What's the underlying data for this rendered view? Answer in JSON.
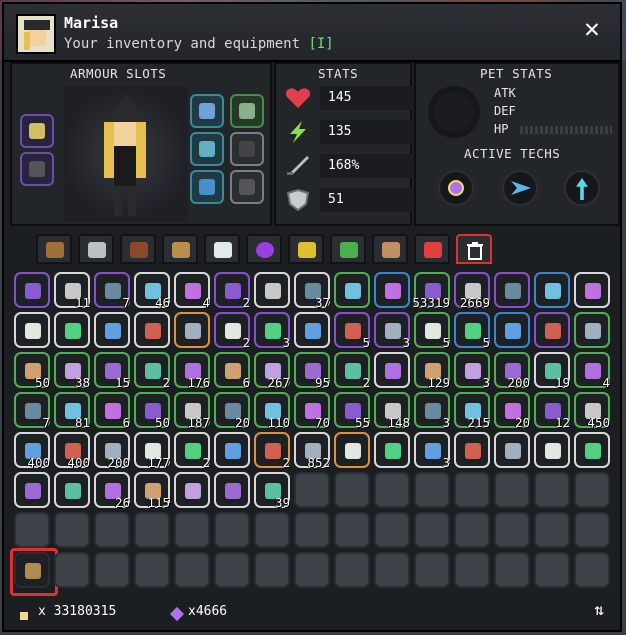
{
  "header": {
    "title": "Marisa",
    "subtitle": "Your inventory and equipment",
    "key_hint": "[I]",
    "close_icon": "close-icon"
  },
  "armour": {
    "title": "ARMOUR SLOTS"
  },
  "stats": {
    "title": "STATS",
    "health": "145",
    "energy": "135",
    "attack": "168%",
    "defense": "51"
  },
  "pet_stats": {
    "title": "PET STATS",
    "atk_label": "ATK",
    "def_label": "DEF",
    "hp_label": "HP"
  },
  "techs": {
    "title": "ACTIVE TECHS"
  },
  "grid": {
    "rows": [
      [
        "",
        "11",
        "7",
        "46",
        "4",
        "2",
        "",
        "37",
        "",
        "",
        "53319",
        "2669",
        "",
        "",
        ""
      ],
      [
        "",
        "",
        "",
        "",
        "",
        "2",
        "3",
        "",
        "5",
        "3",
        "5",
        "5",
        "",
        "",
        ""
      ],
      [
        "50",
        "38",
        "15",
        "2",
        "176",
        "6",
        "267",
        "95",
        "2",
        "",
        "129",
        "3",
        "200",
        "19",
        "4"
      ],
      [
        "7",
        "81",
        "6",
        "50",
        "187",
        "20",
        "110",
        "70",
        "55",
        "148",
        "3",
        "215",
        "20",
        "12",
        "450"
      ],
      [
        "400",
        "400",
        "200",
        "177",
        "2",
        "",
        "2",
        "852",
        "",
        "",
        "3",
        "",
        "",
        "",
        ""
      ],
      [
        "",
        "",
        "26",
        "115",
        "",
        "",
        "39",
        "",
        "",
        "",
        "",
        "",
        "",
        "",
        ""
      ]
    ]
  },
  "footer": {
    "pixels": "x 33180315",
    "essence": "x4666",
    "sort_icon": "sort-icon"
  },
  "colors": {
    "window": "#1c1f22",
    "panel": "#232629",
    "accent_red": "#e03030",
    "key_green": "#6fe26f"
  }
}
